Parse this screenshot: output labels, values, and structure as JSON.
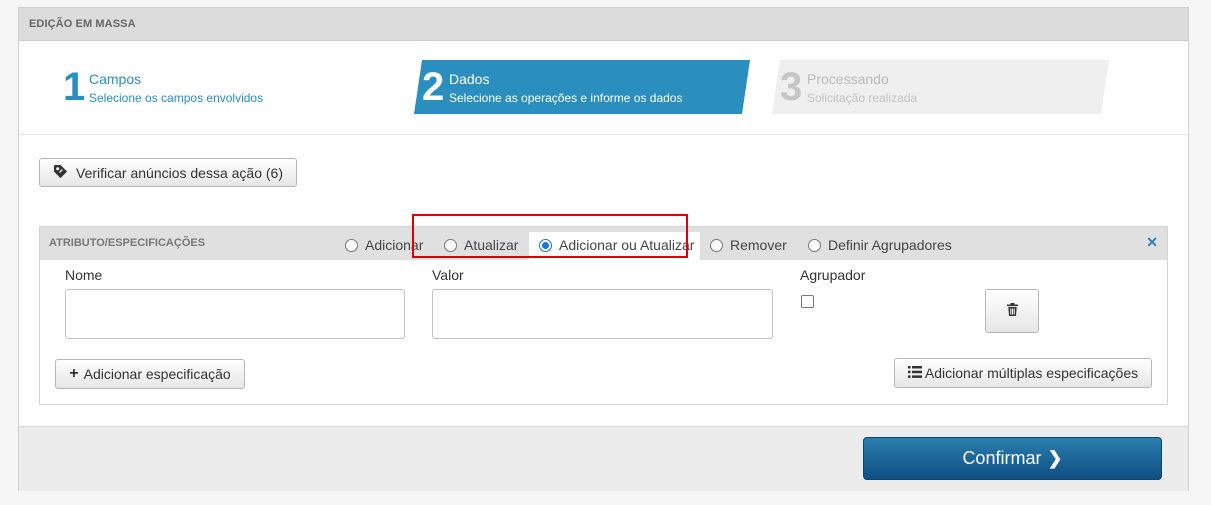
{
  "panel": {
    "title": "EDIÇÃO EM MASSA"
  },
  "steps": [
    {
      "number": "1",
      "title": "Campos",
      "subtitle": "Selecione os campos envolvidos",
      "state": "done"
    },
    {
      "number": "2",
      "title": "Dados",
      "subtitle": "Selecione as operações e informe os dados",
      "state": "active"
    },
    {
      "number": "3",
      "title": "Processando",
      "subtitle": "Solicitação realizada",
      "state": "pending"
    }
  ],
  "verify_button": {
    "label": "Verificar anúncios dessa ação (6)",
    "icon": "tag-icon"
  },
  "attributes": {
    "title": "ATRIBUTO/ESPECIFICAÇÕES",
    "options": [
      {
        "label": "Adicionar",
        "selected": false
      },
      {
        "label": "Atualizar",
        "selected": false
      },
      {
        "label": "Adicionar ou Atualizar",
        "selected": true
      },
      {
        "label": "Remover",
        "selected": false
      },
      {
        "label": "Definir Agrupadores",
        "selected": false
      }
    ],
    "close_icon": "close-icon",
    "name_label": "Nome",
    "name_value": "",
    "value_label": "Valor",
    "value_value": "",
    "grouper_label": "Agrupador",
    "grouper_checked": false,
    "delete_icon": "trash-icon",
    "add_spec_label": "Adicionar especificação",
    "add_multi_label": "Adicionar múltiplas especificações"
  },
  "footer": {
    "confirm_label": "Confirmar"
  },
  "colors": {
    "accent": "#2a8fbf",
    "confirm": "#0e4f82",
    "highlight": "#e00000"
  }
}
